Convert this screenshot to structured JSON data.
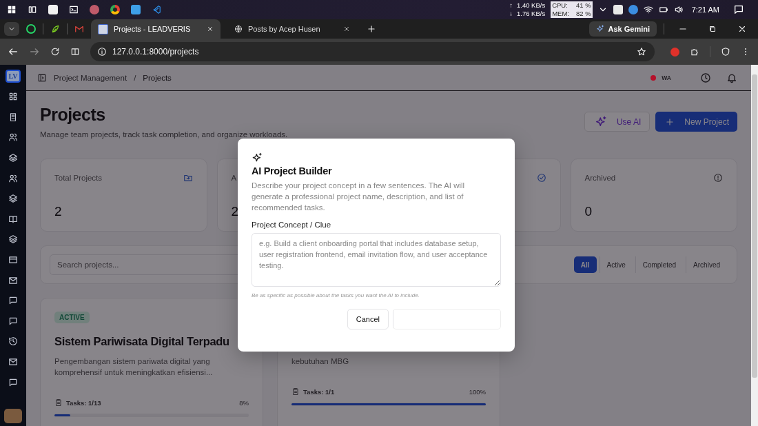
{
  "os_taskbar": {
    "up_arrow": "↑",
    "down_arrow": "↓",
    "net_up": "1.40 KB/s",
    "net_down": "1.76 KB/s",
    "cpu_label": "CPU:",
    "cpu_value": "41 %",
    "mem_label": "MEM:",
    "mem_value": "82 %",
    "time": "7:21 AM"
  },
  "browser": {
    "tabs": [
      {
        "title": "Projects - LEADVERIS",
        "selected": true
      },
      {
        "title": "Posts by Acep Husen",
        "selected": false
      }
    ],
    "gemini": "Ask Gemini",
    "url": "127.0.0.1:8000/projects"
  },
  "sidebar": {
    "logo": "LV"
  },
  "header": {
    "breadcrumb": [
      "Project Management",
      "Projects"
    ],
    "separator": "/",
    "status": {
      "label": "WA",
      "color": "#b5102a"
    }
  },
  "page": {
    "title": "Projects",
    "subtitle": "Manage team projects, track task completion, and organize workloads.",
    "use_ai": "Use AI",
    "new_project": "New Project"
  },
  "stats": [
    {
      "kind": "folder",
      "label": "Total Projects",
      "value": "2"
    },
    {
      "kind": "none",
      "label": "A",
      "value": "2"
    },
    {
      "kind": "check"
    },
    {
      "kind": "info",
      "label": "Archived",
      "value": "0"
    }
  ],
  "filters": {
    "search_placeholder": "Search projects...",
    "tabs": [
      {
        "label": "All",
        "selected": true
      },
      {
        "label": "Active",
        "selected": false
      },
      {
        "label": "Completed",
        "selected": false
      },
      {
        "label": "Archived",
        "selected": false
      }
    ]
  },
  "projects": [
    {
      "status": "ACTIVE",
      "title": "Sistem Pariwisata Digital Terpadu",
      "description": "Pengembangan sistem pariwata digital yang komprehensif untuk meningkatkan efisiensi...",
      "tasks": "Tasks: 1/13",
      "percent": "8%",
      "level": 0.08
    },
    {
      "description": "kebutuhan MBG",
      "tasks": "Tasks: 1/1",
      "percent": "100%",
      "level": 1
    }
  ],
  "modal": {
    "title": "AI Project Builder",
    "description": "Describe your project concept in a few sentences. The AI will generate a professional project name, description, and list of recommended tasks.",
    "field_label": "Project Concept / Clue",
    "placeholder": "e.g. Build a client onboarding portal that includes database setup, user registration frontend, email invitation flow, and user acceptance testing.",
    "hint": "Be as specific as possible about the tasks you want the AI to include.",
    "cancel": "Cancel"
  }
}
